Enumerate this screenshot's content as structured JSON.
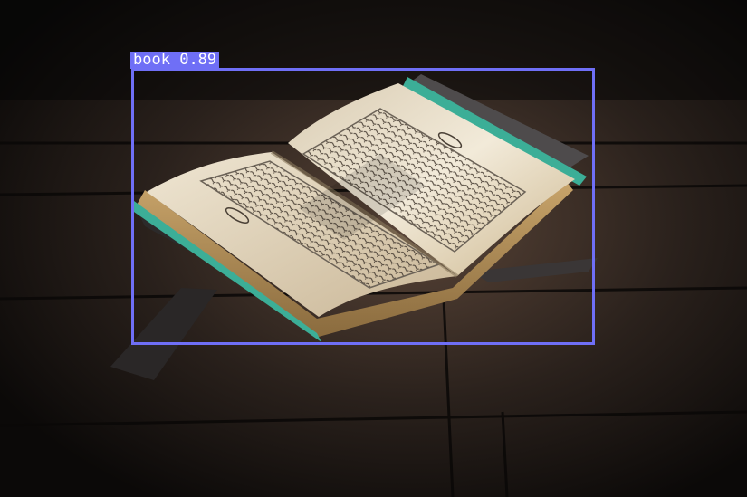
{
  "detection": {
    "class_label": "book",
    "confidence": "0.89",
    "box_color": "#6f6ff6",
    "label_text_color": "#ffffff"
  },
  "scene": {
    "subject": "open-book-on-wooden-stand",
    "background": "dark-wooden-floor"
  }
}
